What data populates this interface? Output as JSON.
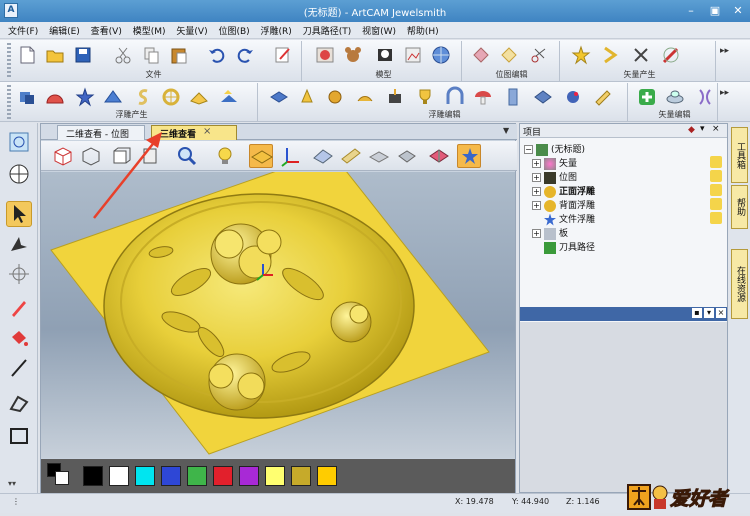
{
  "window": {
    "title": "(无标题) - ArtCAM Jewelsmith",
    "app_icon": "artcam-app-icon"
  },
  "menu": [
    "文件(F)",
    "编辑(E)",
    "查看(V)",
    "模型(M)",
    "矢量(V)",
    "位图(B)",
    "浮雕(R)",
    "刀具路径(T)",
    "视窗(W)",
    "帮助(H)"
  ],
  "toolbar_groups": {
    "file": "文件",
    "model": "模型",
    "bitmap": "位图编辑",
    "vector_gen": "矢量产生",
    "relief_gen": "浮雕产生",
    "relief_edit": "浮雕编辑",
    "vector_edit": "矢量编辑"
  },
  "tabs": {
    "tab1": "二维查看 - 位图层",
    "tab2": "三维查看",
    "close": "×"
  },
  "project": {
    "header": "项目",
    "root": "(无标题)",
    "items": [
      "矢量",
      "位图",
      "正面浮雕",
      "背面浮雕",
      "文件浮雕",
      "板",
      "刀具路径"
    ]
  },
  "side_tabs": [
    "工具箱",
    "帮助",
    "在线资源"
  ],
  "status": {
    "x": "X: 19.478",
    "y": "Y: 44.940",
    "z": "Z: 1.146"
  },
  "palette": [
    "#000000",
    "#ffffff",
    "#00e5f0",
    "#2e47d6",
    "#3fb54a",
    "#e2202c",
    "#a829d6",
    "#ffff70",
    "#c6aa2a",
    "#ffcc00"
  ],
  "accent_color": "#e8402a",
  "logo_text": "爱好者"
}
